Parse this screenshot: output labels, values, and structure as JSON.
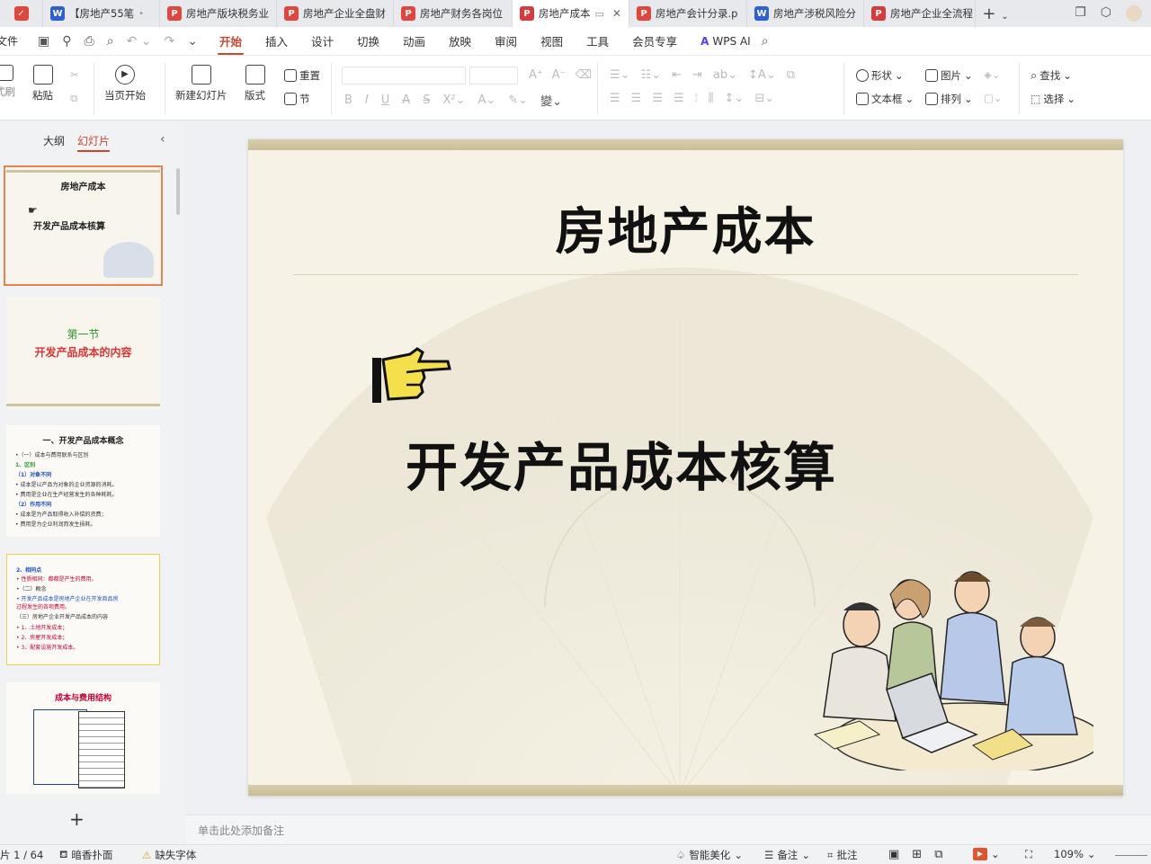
{
  "tabs": [
    {
      "label": "【房地产55笔",
      "type": "w",
      "suffix": "•"
    },
    {
      "label": "房地产版块税务业",
      "type": "pdf"
    },
    {
      "label": "房地产企业全盘财",
      "type": "pdf"
    },
    {
      "label": "房地产财务各岗位",
      "type": "pdf"
    },
    {
      "label": "房地产成本",
      "type": "p",
      "active": true
    },
    {
      "label": "房地产会计分录.p",
      "type": "pdf"
    },
    {
      "label": "房地产涉税风险分",
      "type": "w"
    },
    {
      "label": "房地产企业全流程",
      "type": "p"
    }
  ],
  "menu": {
    "file": "文件",
    "items": [
      "开始",
      "插入",
      "设计",
      "切换",
      "动画",
      "放映",
      "审阅",
      "视图",
      "工具",
      "会员专享"
    ],
    "active": "开始",
    "wps_ai": "WPS AI"
  },
  "ribbon": {
    "format_painter": "式刷",
    "paste": "粘贴",
    "play_from_current": "当页开始",
    "new_slide": "新建幻灯片",
    "layout": "版式",
    "reset": "重置",
    "section": "节",
    "shape": "形状",
    "picture": "图片",
    "textbox": "文本框",
    "arrange": "排列",
    "find": "查找",
    "select": "选择"
  },
  "left_panel": {
    "tab_outline": "大纲",
    "tab_slides": "幻灯片",
    "thumbs": {
      "t1_title": "房地产成本",
      "t1_sub": "开发产品成本核算",
      "t2_line1": "第一节",
      "t2_line2": "开发产品成本的内容",
      "t3_title": "一、开发产品成本概念",
      "t3_lines": [
        "•（一）成本与费用联系与区别",
        "1、区别",
        "（1）对象不同",
        "• 成本是以产品为对象的企业资源的消耗。",
        "• 费用是企业在生产经营发生的各种耗耗。",
        "（2）作用不同",
        "• 成本是为产品取得收入补偿的资费；",
        "• 费用是为企业利润而发生损耗。"
      ],
      "t4_lines": [
        "2、相同点",
        "• 性质相同：都都是产生的费用。",
        "•（二）概念",
        "• 开发产品成本是房地产企业在开发商品房",
        "  过程发生的各项费用。",
        "（三）房地产企业开发产品成本的内容",
        "• 1、土地开发成本；",
        "• 2、房屋开发成本；",
        "• 3、配套设施开发成本。"
      ],
      "t5_title": "成本与费用结构"
    }
  },
  "slide": {
    "title": "房地产成本",
    "subtitle": "开发产品成本核算"
  },
  "notes_placeholder": "单击此处添加备注",
  "status": {
    "page": "片 1 / 64",
    "theme": "暗香扑面",
    "missing_font": "缺失字体",
    "smart_beautify": "智能美化",
    "notes": "备注",
    "comments": "批注",
    "zoom": "109%"
  }
}
